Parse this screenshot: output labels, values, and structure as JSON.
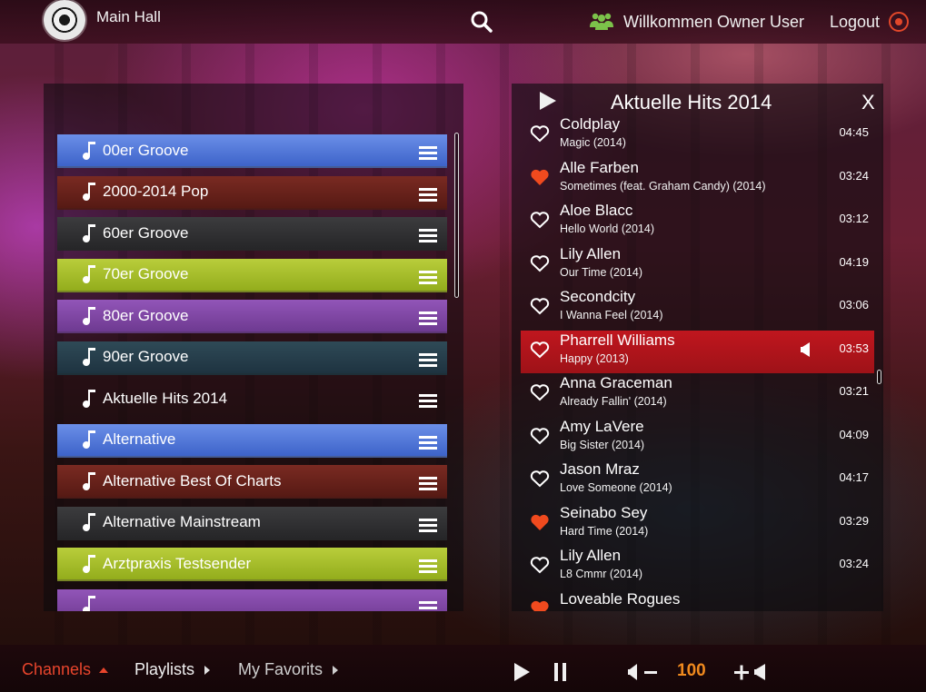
{
  "header": {
    "hall_title": "Main Hall",
    "welcome_text": "Willkommen Owner User",
    "logout_label": "Logout"
  },
  "channels": [
    {
      "label": "00er Groove",
      "color": "blue"
    },
    {
      "label": "2000-2014 Pop",
      "color": "brown"
    },
    {
      "label": "60er Groove",
      "color": "dark"
    },
    {
      "label": "70er Groove",
      "color": "green"
    },
    {
      "label": "80er Groove",
      "color": "purple"
    },
    {
      "label": "90er Groove",
      "color": "teal"
    },
    {
      "label": "Aktuelle Hits 2014",
      "color": "none"
    },
    {
      "label": "Alternative",
      "color": "blue"
    },
    {
      "label": "Alternative Best Of Charts",
      "color": "brown"
    },
    {
      "label": "Alternative Mainstream",
      "color": "dark"
    },
    {
      "label": "Arztpraxis Testsender",
      "color": "green"
    },
    {
      "label": "",
      "color": "purple"
    }
  ],
  "playlist": {
    "title": "Aktuelle Hits 2014",
    "close_label": "X",
    "tracks": [
      {
        "artist": "Coldplay",
        "song": "Magic (2014)",
        "duration": "04:45",
        "favorite": false,
        "playing": false
      },
      {
        "artist": "Alle Farben",
        "song": "Sometimes (feat. Graham Candy) (2014)",
        "duration": "03:24",
        "favorite": true,
        "playing": false
      },
      {
        "artist": "Aloe Blacc",
        "song": "Hello World (2014)",
        "duration": "03:12",
        "favorite": false,
        "playing": false
      },
      {
        "artist": "Lily Allen",
        "song": "Our Time (2014)",
        "duration": "04:19",
        "favorite": false,
        "playing": false
      },
      {
        "artist": "Secondcity",
        "song": "I Wanna Feel (2014)",
        "duration": "03:06",
        "favorite": false,
        "playing": false
      },
      {
        "artist": "Pharrell Williams",
        "song": "Happy (2013)",
        "duration": "03:53",
        "favorite": false,
        "playing": true
      },
      {
        "artist": "Anna Graceman",
        "song": "Already Fallin' (2014)",
        "duration": "03:21",
        "favorite": false,
        "playing": false
      },
      {
        "artist": "Amy LaVere",
        "song": "Big Sister (2014)",
        "duration": "04:09",
        "favorite": false,
        "playing": false
      },
      {
        "artist": "Jason Mraz",
        "song": "Love Someone (2014)",
        "duration": "04:17",
        "favorite": false,
        "playing": false
      },
      {
        "artist": "Seinabo Sey",
        "song": "Hard Time (2014)",
        "duration": "03:29",
        "favorite": true,
        "playing": false
      },
      {
        "artist": "Lily Allen",
        "song": "L8 Cmmr (2014)",
        "duration": "03:24",
        "favorite": false,
        "playing": false
      },
      {
        "artist": "Loveable Rogues",
        "song": "",
        "duration": "",
        "favorite": true,
        "playing": false
      }
    ]
  },
  "footer": {
    "nav_channels": "Channels",
    "nav_playlists": "Playlists",
    "nav_favorites": "My Favorits",
    "volume": "100"
  },
  "colors": {
    "accent_red": "#e8452c",
    "volume_orange": "#f08a1e",
    "heart_favorite": "#f04a1e",
    "active_track": "#c0161e",
    "user_icon_green": "#7cc24a"
  },
  "icons": {
    "search": "search-icon",
    "user": "users-icon",
    "logout": "power-icon",
    "note": "music-note-icon",
    "menu": "hamburger-icon",
    "heart": "heart-icon",
    "speaker": "speaker-icon"
  }
}
